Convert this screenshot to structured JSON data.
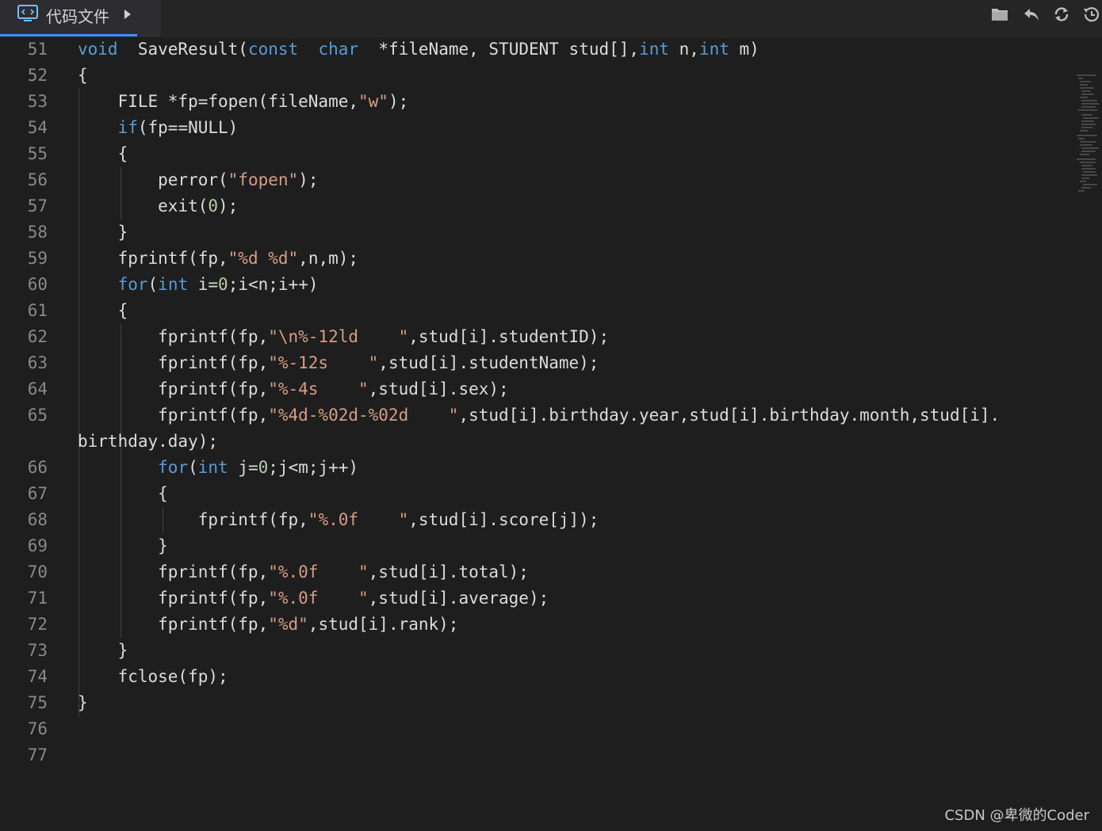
{
  "tab": {
    "label": "代码文件",
    "icon": "code-file-icon",
    "arrow_icon": "chevron-right-icon"
  },
  "toolbar": {
    "icons": [
      "folder-icon",
      "undo-icon",
      "refresh-icon",
      "history-icon"
    ]
  },
  "code_lines": [
    {
      "num": "51",
      "tokens": [
        [
          "kw",
          "void"
        ],
        [
          "",
          "  SaveResult("
        ],
        [
          "kw",
          "const"
        ],
        [
          "",
          "  "
        ],
        [
          "kw",
          "char"
        ],
        [
          "",
          "  *fileName, STUDENT stud[],"
        ],
        [
          "kw",
          "int"
        ],
        [
          "",
          " n,"
        ],
        [
          "kw",
          "int"
        ],
        [
          "",
          " m)"
        ]
      ]
    },
    {
      "num": "52",
      "tokens": [
        [
          "",
          "{"
        ]
      ]
    },
    {
      "num": "53",
      "tokens": [
        [
          "",
          "    FILE *fp=fopen(fileName,"
        ],
        [
          "str",
          "\"w\""
        ],
        [
          "",
          ");"
        ]
      ]
    },
    {
      "num": "54",
      "tokens": [
        [
          "",
          "    "
        ],
        [
          "kw",
          "if"
        ],
        [
          "",
          "(fp==NULL)"
        ]
      ]
    },
    {
      "num": "55",
      "tokens": [
        [
          "",
          "    {"
        ]
      ]
    },
    {
      "num": "56",
      "tokens": [
        [
          "",
          "        perror("
        ],
        [
          "str",
          "\"fopen\""
        ],
        [
          "",
          ");"
        ]
      ]
    },
    {
      "num": "57",
      "tokens": [
        [
          "",
          "        exit("
        ],
        [
          "num",
          "0"
        ],
        [
          "",
          ");"
        ]
      ]
    },
    {
      "num": "58",
      "tokens": [
        [
          "",
          "    }"
        ]
      ]
    },
    {
      "num": "59",
      "tokens": [
        [
          "",
          "    fprintf(fp,"
        ],
        [
          "str",
          "\"%d %d\""
        ],
        [
          "",
          ",n,m);"
        ]
      ]
    },
    {
      "num": "60",
      "tokens": [
        [
          "",
          "    "
        ],
        [
          "kw",
          "for"
        ],
        [
          "",
          "("
        ],
        [
          "kw",
          "int"
        ],
        [
          "",
          " i="
        ],
        [
          "num",
          "0"
        ],
        [
          "",
          ";i<n;i++)"
        ]
      ]
    },
    {
      "num": "61",
      "tokens": [
        [
          "",
          "    {"
        ]
      ]
    },
    {
      "num": "62",
      "tokens": [
        [
          "",
          "        fprintf(fp,"
        ],
        [
          "str",
          "\"\\n%-12ld    \""
        ],
        [
          "",
          ",stud[i].studentID);"
        ]
      ]
    },
    {
      "num": "63",
      "tokens": [
        [
          "",
          "        fprintf(fp,"
        ],
        [
          "str",
          "\"%-12s    \""
        ],
        [
          "",
          ",stud[i].studentName);"
        ]
      ]
    },
    {
      "num": "64",
      "tokens": [
        [
          "",
          "        fprintf(fp,"
        ],
        [
          "str",
          "\"%-4s    \""
        ],
        [
          "",
          ",stud[i].sex);"
        ]
      ]
    },
    {
      "num": "65",
      "tokens": [
        [
          "",
          "        fprintf(fp,"
        ],
        [
          "str",
          "\"%4d-%02d-%02d    \""
        ],
        [
          "",
          ",stud[i].birthday.year,stud[i].birthday.month,stud[i]."
        ]
      ]
    },
    {
      "num": "",
      "tokens": [
        [
          "",
          "birthday.day);"
        ]
      ]
    },
    {
      "num": "66",
      "tokens": [
        [
          "",
          "        "
        ],
        [
          "kw",
          "for"
        ],
        [
          "",
          "("
        ],
        [
          "kw",
          "int"
        ],
        [
          "",
          " j="
        ],
        [
          "num",
          "0"
        ],
        [
          "",
          ";j<m;j++)"
        ]
      ]
    },
    {
      "num": "67",
      "tokens": [
        [
          "",
          "        {"
        ]
      ]
    },
    {
      "num": "68",
      "tokens": [
        [
          "",
          "            fprintf(fp,"
        ],
        [
          "str",
          "\"%.0f    \""
        ],
        [
          "",
          ",stud[i].score[j]);"
        ]
      ]
    },
    {
      "num": "69",
      "tokens": [
        [
          "",
          "        }"
        ]
      ]
    },
    {
      "num": "70",
      "tokens": [
        [
          "",
          "        fprintf(fp,"
        ],
        [
          "str",
          "\"%.0f    \""
        ],
        [
          "",
          ",stud[i].total);"
        ]
      ]
    },
    {
      "num": "71",
      "tokens": [
        [
          "",
          "        fprintf(fp,"
        ],
        [
          "str",
          "\"%.0f    \""
        ],
        [
          "",
          ",stud[i].average);"
        ]
      ]
    },
    {
      "num": "72",
      "tokens": [
        [
          "",
          "        fprintf(fp,"
        ],
        [
          "str",
          "\"%d\""
        ],
        [
          "",
          ",stud[i].rank);"
        ]
      ]
    },
    {
      "num": "73",
      "tokens": [
        [
          "",
          "    }"
        ]
      ]
    },
    {
      "num": "74",
      "tokens": [
        [
          "",
          "    fclose(fp);"
        ]
      ]
    },
    {
      "num": "75",
      "tokens": [
        [
          "",
          "}"
        ]
      ]
    },
    {
      "num": "76",
      "tokens": []
    },
    {
      "num": "77",
      "tokens": []
    }
  ],
  "watermark": "CSDN @卑微的Coder",
  "colors": {
    "background": "#1e1e1e",
    "keyword": "#569cd6",
    "string": "#d69d85",
    "number": "#b5cea8",
    "text": "#dcdcdc",
    "line_number": "#8a8a8a",
    "tab_accent": "#3794ff"
  }
}
